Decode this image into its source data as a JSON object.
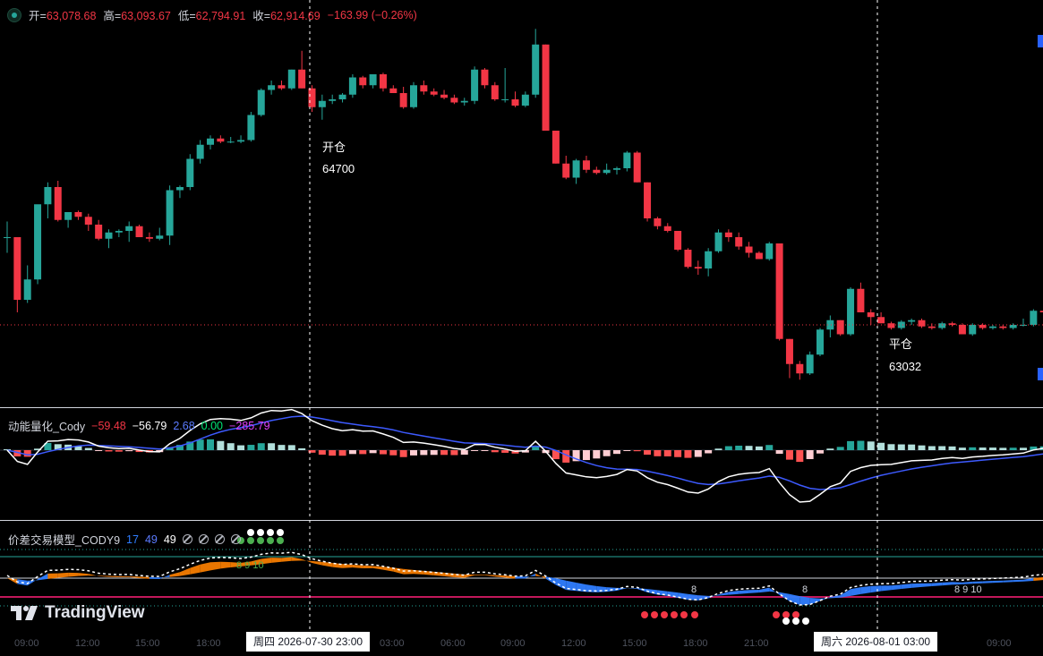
{
  "ohlc": {
    "open_label": "开=",
    "open": "63,078.68",
    "high_label": "高=",
    "high": "63,093.67",
    "low_label": "低=",
    "low": "62,794.91",
    "close_label": "收=",
    "close": "62,914.69",
    "change": "−163.99 (−0.26%)"
  },
  "annotations": {
    "open_position": {
      "label": "开仓",
      "price": "64700"
    },
    "close_position": {
      "label": "平仓",
      "price": "63032"
    }
  },
  "indicator1": {
    "name": "动能量化_Cody",
    "values": [
      {
        "text": "−59.48",
        "color": "#f23645"
      },
      {
        "text": "−56.79",
        "color": "#ffffff"
      },
      {
        "text": "2.68",
        "color": "#5b7bff"
      },
      {
        "text": "0.00",
        "color": "#00e676"
      },
      {
        "text": "−285.79",
        "color": "#e040fb"
      }
    ]
  },
  "indicator2": {
    "name": "价差交易模型_CODY9",
    "values": [
      {
        "text": "17",
        "color": "#2f7dff"
      },
      {
        "text": "49",
        "color": "#5b7bff"
      },
      {
        "text": "49",
        "color": "#ffffff"
      }
    ],
    "na_count": 4,
    "signal_labels": {
      "a": "8 9 10",
      "b": "8",
      "c": "8",
      "d": "8 9 10"
    }
  },
  "logo": {
    "text": "TradingView"
  },
  "time_axis": {
    "labels": [
      {
        "text": "09:00"
      },
      {
        "text": "12:00"
      },
      {
        "text": "15:00"
      },
      {
        "text": "18:00"
      },
      {
        "text": "03:00"
      },
      {
        "text": "06:00"
      },
      {
        "text": "09:00"
      },
      {
        "text": "12:00"
      },
      {
        "text": "15:00"
      },
      {
        "text": "18:00"
      },
      {
        "text": "21:00"
      },
      {
        "text": "09:00"
      }
    ],
    "crosshair_1": "周四 2026-07-30   23:00",
    "crosshair_2": "周六  2026-08-01   03:00"
  },
  "colors": {
    "up": "#26a69a",
    "down": "#f23645",
    "background": "#000000",
    "macd_fast": "#ffffff",
    "macd_slow": "#2962ff"
  },
  "chart_data": {
    "type": "candlestick",
    "candles": [
      [
        63650,
        63750,
        63550,
        63650
      ],
      [
        63650,
        63650,
        63170,
        63250
      ],
      [
        63250,
        63470,
        63230,
        63380
      ],
      [
        63380,
        63830,
        63350,
        63860
      ],
      [
        63860,
        64000,
        63770,
        63970
      ],
      [
        63970,
        64010,
        63750,
        63760
      ],
      [
        63760,
        63810,
        63710,
        63810
      ],
      [
        63810,
        63820,
        63760,
        63780
      ],
      [
        63780,
        63800,
        63690,
        63730
      ],
      [
        63730,
        63760,
        63630,
        63640
      ],
      [
        63640,
        63700,
        63580,
        63680
      ],
      [
        63680,
        63700,
        63650,
        63690
      ],
      [
        63690,
        63750,
        63620,
        63720
      ],
      [
        63720,
        63730,
        63650,
        63650
      ],
      [
        63650,
        63680,
        63620,
        63640
      ],
      [
        63640,
        63710,
        63630,
        63660
      ],
      [
        63660,
        63980,
        63600,
        63950
      ],
      [
        63950,
        63980,
        63900,
        63970
      ],
      [
        63970,
        64180,
        63950,
        64150
      ],
      [
        64150,
        64270,
        64120,
        64240
      ],
      [
        64240,
        64300,
        64210,
        64280
      ],
      [
        64280,
        64300,
        64250,
        64260
      ],
      [
        64260,
        64290,
        64250,
        64260
      ],
      [
        64260,
        64300,
        64250,
        64270
      ],
      [
        64270,
        64450,
        64260,
        64430
      ],
      [
        64430,
        64600,
        64420,
        64590
      ],
      [
        64590,
        64650,
        64560,
        64620
      ],
      [
        64620,
        64650,
        64590,
        64600
      ],
      [
        64600,
        64720,
        64590,
        64720
      ],
      [
        64720,
        64840,
        64600,
        64600
      ],
      [
        64600,
        64620,
        64450,
        64480
      ],
      [
        64480,
        64560,
        64400,
        64520
      ],
      [
        64520,
        64560,
        64500,
        64530
      ],
      [
        64530,
        64570,
        64510,
        64560
      ],
      [
        64560,
        64690,
        64540,
        64670
      ],
      [
        64670,
        64680,
        64600,
        64620
      ],
      [
        64620,
        64690,
        64600,
        64690
      ],
      [
        64690,
        64700,
        64580,
        64600
      ],
      [
        64600,
        64620,
        64570,
        64570
      ],
      [
        64570,
        64610,
        64470,
        64480
      ],
      [
        64480,
        64640,
        64470,
        64620
      ],
      [
        64620,
        64650,
        64560,
        64580
      ],
      [
        64580,
        64600,
        64550,
        64560
      ],
      [
        64560,
        64590,
        64530,
        64540
      ],
      [
        64540,
        64560,
        64500,
        64510
      ],
      [
        64510,
        64540,
        64490,
        64520
      ],
      [
        64520,
        64740,
        64500,
        64720
      ],
      [
        64720,
        64730,
        64600,
        64620
      ],
      [
        64620,
        64640,
        64520,
        64530
      ],
      [
        64530,
        64730,
        64510,
        64530
      ],
      [
        64530,
        64580,
        64480,
        64490
      ],
      [
        64490,
        64580,
        64480,
        64560
      ],
      [
        64560,
        64980,
        64540,
        64880
      ],
      [
        64880,
        64880,
        64330,
        64330
      ],
      [
        64330,
        64330,
        64120,
        64120
      ],
      [
        64120,
        64170,
        64020,
        64030
      ],
      [
        64030,
        64150,
        63990,
        64140
      ],
      [
        64140,
        64170,
        64060,
        64080
      ],
      [
        64080,
        64100,
        64050,
        64060
      ],
      [
        64060,
        64120,
        64050,
        64080
      ],
      [
        64080,
        64100,
        64050,
        64090
      ],
      [
        64090,
        64200,
        64070,
        64190
      ],
      [
        64190,
        64200,
        64000,
        64000
      ],
      [
        64000,
        64000,
        63750,
        63770
      ],
      [
        63770,
        63780,
        63700,
        63720
      ],
      [
        63720,
        63740,
        63680,
        63690
      ],
      [
        63690,
        63690,
        63560,
        63570
      ],
      [
        63570,
        63580,
        63450,
        63460
      ],
      [
        63460,
        63500,
        63410,
        63450
      ],
      [
        63450,
        63580,
        63400,
        63560
      ],
      [
        63560,
        63700,
        63550,
        63680
      ],
      [
        63680,
        63700,
        63620,
        63650
      ],
      [
        63650,
        63680,
        63570,
        63590
      ],
      [
        63590,
        63620,
        63520,
        63550
      ],
      [
        63550,
        63560,
        63510,
        63510
      ],
      [
        63510,
        63620,
        63500,
        63610
      ],
      [
        63610,
        63610,
        62990,
        63000
      ],
      [
        63000,
        63000,
        62750,
        62840
      ],
      [
        62840,
        62860,
        62740,
        62780
      ],
      [
        62780,
        62920,
        62770,
        62900
      ],
      [
        62900,
        63070,
        62890,
        63060
      ],
      [
        63060,
        63150,
        63010,
        63120
      ],
      [
        63120,
        63120,
        63020,
        63030
      ],
      [
        63030,
        63330,
        63020,
        63320
      ],
      [
        63320,
        63360,
        63170,
        63170
      ],
      [
        63170,
        63190,
        63090,
        63140
      ],
      [
        63140,
        63170,
        63100,
        63100
      ],
      [
        63100,
        63110,
        63060,
        63070
      ],
      [
        63070,
        63120,
        63060,
        63110
      ],
      [
        63110,
        63130,
        63090,
        63120
      ],
      [
        63120,
        63130,
        63070,
        63080
      ],
      [
        63080,
        63100,
        63060,
        63070
      ],
      [
        63070,
        63110,
        63060,
        63100
      ],
      [
        63100,
        63110,
        63080,
        63090
      ],
      [
        63090,
        63100,
        63030,
        63030
      ],
      [
        63030,
        63100,
        63020,
        63090
      ],
      [
        63090,
        63100,
        63060,
        63070
      ],
      [
        63070,
        63090,
        63060,
        63080
      ],
      [
        63080,
        63090,
        63060,
        63070
      ],
      [
        63070,
        63100,
        63060,
        63090
      ],
      [
        63090,
        63130,
        63080,
        63090
      ],
      [
        63090,
        63190,
        63080,
        63180
      ],
      [
        63180,
        63200,
        63150,
        63170
      ],
      [
        63170,
        63180,
        63110,
        63140
      ]
    ]
  }
}
